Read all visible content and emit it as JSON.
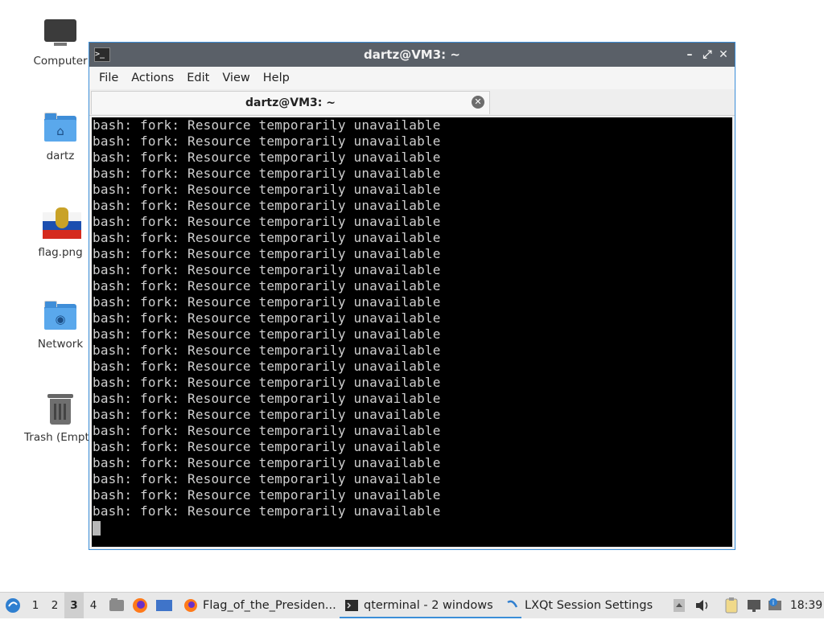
{
  "desktop": {
    "icons": [
      {
        "label": "Computer"
      },
      {
        "label": "dartz"
      },
      {
        "label": "flag.png"
      },
      {
        "label": "Network"
      },
      {
        "label": "Trash (Empty)"
      }
    ]
  },
  "window": {
    "title": "dartz@VM3: ~",
    "controls": {
      "minimize": "–",
      "maximize": "⤢",
      "close": "✕"
    },
    "menu": [
      "File",
      "Actions",
      "Edit",
      "View",
      "Help"
    ],
    "tab": {
      "label": "dartz@VM3: ~",
      "close": "✕"
    }
  },
  "terminal": {
    "lines": [
      "bash: fork: Resource temporarily unavailable",
      "bash: fork: Resource temporarily unavailable",
      "bash: fork: Resource temporarily unavailable",
      "bash: fork: Resource temporarily unavailable",
      "bash: fork: Resource temporarily unavailable",
      "bash: fork: Resource temporarily unavailable",
      "bash: fork: Resource temporarily unavailable",
      "bash: fork: Resource temporarily unavailable",
      "bash: fork: Resource temporarily unavailable",
      "bash: fork: Resource temporarily unavailable",
      "bash: fork: Resource temporarily unavailable",
      "bash: fork: Resource temporarily unavailable",
      "bash: fork: Resource temporarily unavailable",
      "bash: fork: Resource temporarily unavailable",
      "bash: fork: Resource temporarily unavailable",
      "bash: fork: Resource temporarily unavailable",
      "bash: fork: Resource temporarily unavailable",
      "bash: fork: Resource temporarily unavailable",
      "bash: fork: Resource temporarily unavailable",
      "bash: fork: Resource temporarily unavailable",
      "bash: fork: Resource temporarily unavailable",
      "bash: fork: Resource temporarily unavailable",
      "bash: fork: Resource temporarily unavailable",
      "bash: fork: Resource temporarily unavailable",
      "bash: fork: Resource temporarily unavailable"
    ]
  },
  "taskbar": {
    "workspaces": [
      "1",
      "2",
      "3",
      "4"
    ],
    "active_workspace": "3",
    "tasks": [
      {
        "label": "Flag_of_the_Presiden..."
      },
      {
        "label": "qterminal - 2 windows"
      },
      {
        "label": "LXQt Session Settings"
      }
    ],
    "clock": "18:39"
  }
}
